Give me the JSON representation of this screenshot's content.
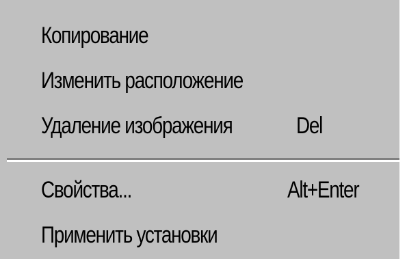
{
  "menu": {
    "items": [
      {
        "label": "Копирование",
        "shortcut": ""
      },
      {
        "label": "Изменить расположение",
        "shortcut": ""
      },
      {
        "label": "Удаление изображения",
        "shortcut": "Del"
      },
      {
        "label": "Свойства...",
        "shortcut": "Alt+Enter"
      },
      {
        "label": "Применить установки",
        "shortcut": ""
      }
    ]
  },
  "colors": {
    "menu_background": "#c0c0c0",
    "text": "#000000",
    "separator_shadow": "#808080",
    "separator_highlight": "#ffffff"
  }
}
